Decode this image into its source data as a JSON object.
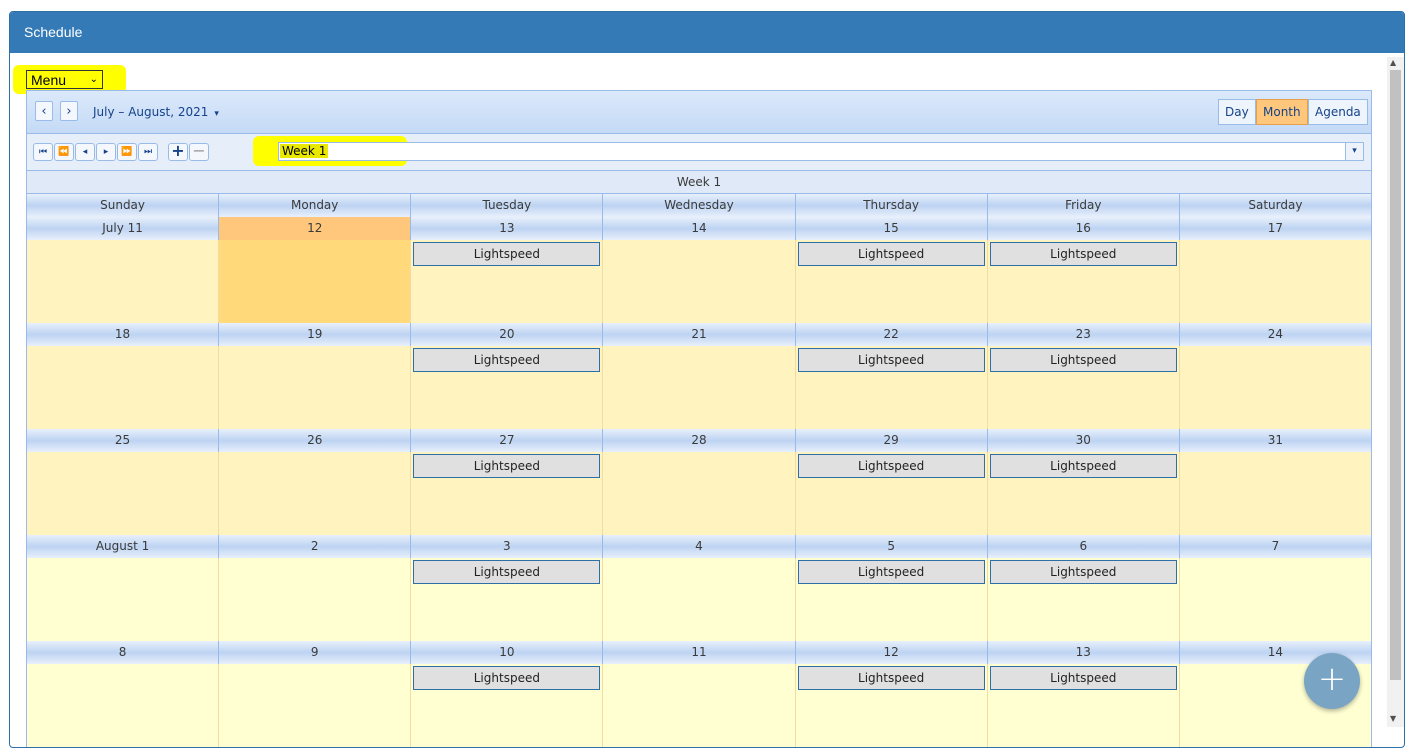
{
  "panel": {
    "title": "Schedule"
  },
  "menu": {
    "selected": "Menu",
    "arrow": "⌄"
  },
  "toolbar": {
    "prev_icon": "chevron-left-icon",
    "next_icon": "chevron-right-icon",
    "prev_glyph": "‹",
    "next_glyph": "›",
    "date_range": "July – August, 2021",
    "range_caret": "▾",
    "views": [
      "Day",
      "Month",
      "Agenda"
    ],
    "active_view": "Month"
  },
  "timeline": {
    "buttons": [
      {
        "name": "first-button",
        "glyph": "⏮"
      },
      {
        "name": "rewind-button",
        "glyph": "⏪"
      },
      {
        "name": "step-back-button",
        "glyph": "◂"
      },
      {
        "name": "step-forward-button",
        "glyph": "▸"
      },
      {
        "name": "fast-forward-button",
        "glyph": "⏩"
      },
      {
        "name": "last-button",
        "glyph": "⏭"
      },
      {
        "name": "add-button",
        "glyph": "+"
      },
      {
        "name": "remove-button",
        "glyph": "−"
      }
    ],
    "week_select": "Week 1",
    "drop_glyph": "▾"
  },
  "week_label": "Week 1",
  "day_headers": [
    "Sunday",
    "Monday",
    "Tuesday",
    "Wednesday",
    "Thursday",
    "Friday",
    "Saturday"
  ],
  "weeks": [
    {
      "dates": [
        "July 11",
        "12",
        "13",
        "14",
        "15",
        "16",
        "17"
      ],
      "events": [
        null,
        null,
        "Lightspeed",
        null,
        "Lightspeed",
        "Lightspeed",
        null
      ],
      "today_index": 1,
      "shade": "current"
    },
    {
      "dates": [
        "18",
        "19",
        "20",
        "21",
        "22",
        "23",
        "24"
      ],
      "events": [
        null,
        null,
        "Lightspeed",
        null,
        "Lightspeed",
        "Lightspeed",
        null
      ],
      "shade": "current"
    },
    {
      "dates": [
        "25",
        "26",
        "27",
        "28",
        "29",
        "30",
        "31"
      ],
      "events": [
        null,
        null,
        "Lightspeed",
        null,
        "Lightspeed",
        "Lightspeed",
        null
      ],
      "shade": "current"
    },
    {
      "dates": [
        "August 1",
        "2",
        "3",
        "4",
        "5",
        "6",
        "7"
      ],
      "events": [
        null,
        null,
        "Lightspeed",
        null,
        "Lightspeed",
        "Lightspeed",
        null
      ],
      "shade": "next"
    },
    {
      "dates": [
        "8",
        "9",
        "10",
        "11",
        "12",
        "13",
        "14"
      ],
      "events": [
        null,
        null,
        "Lightspeed",
        null,
        "Lightspeed",
        "Lightspeed",
        null
      ],
      "shade": "next"
    }
  ],
  "fab": {
    "glyph": "+"
  },
  "scrollbar": {
    "up": "▲",
    "down": "▼"
  },
  "colors": {
    "header_blue": "#337ab7",
    "today": "#ffc77b",
    "highlight": "#ffff00",
    "cell": "#fff3bf",
    "event_border": "#2f6fa8"
  }
}
